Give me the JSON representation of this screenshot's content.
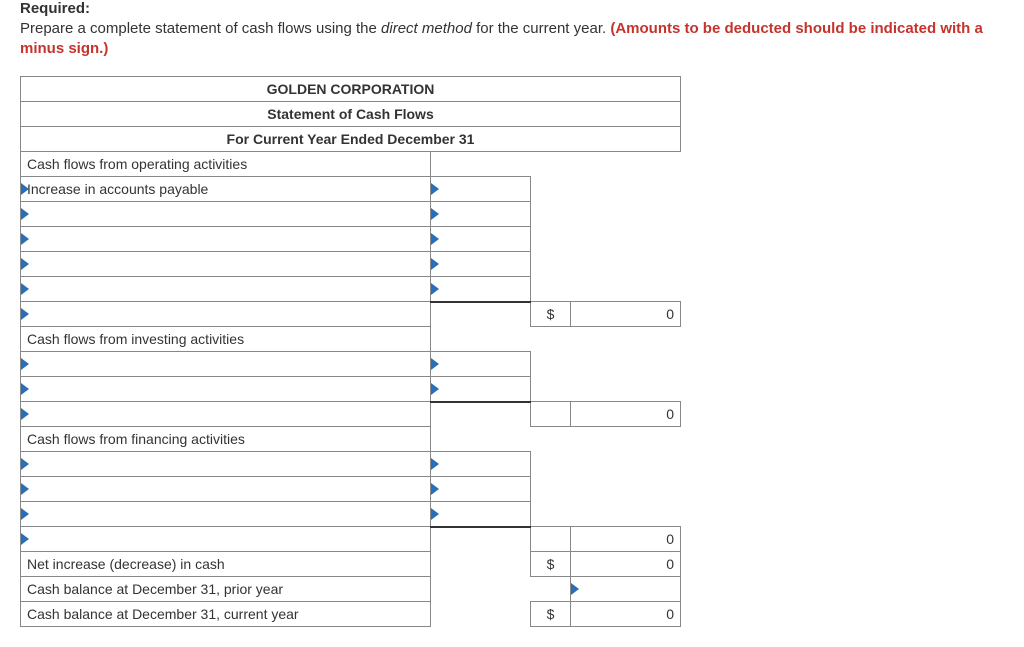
{
  "header": {
    "required_label": "Required:",
    "instruction_pre": "Prepare a complete statement of cash flows using the ",
    "instruction_italic": "direct method",
    "instruction_mid": " for the current year. ",
    "instruction_red": "(Amounts to be deducted should be indicated with a minus sign.)"
  },
  "titles": {
    "company": "GOLDEN CORPORATION",
    "statement": "Statement of Cash Flows",
    "period": "For Current Year Ended December 31"
  },
  "sections": {
    "operating": "Cash flows from operating activities",
    "investing": "Cash flows from investing activities",
    "financing": "Cash flows from financing activities",
    "net_change": "Net increase (decrease) in cash",
    "prior_balance": "Cash balance at December 31, prior year",
    "current_balance": "Cash balance at December 31, current year"
  },
  "rows": {
    "op_item1": "Increase in accounts payable"
  },
  "symbols": {
    "dollar": "$"
  },
  "values": {
    "operating_total": "0",
    "investing_total": "0",
    "financing_total": "0",
    "net_change": "0",
    "current_balance": "0"
  }
}
